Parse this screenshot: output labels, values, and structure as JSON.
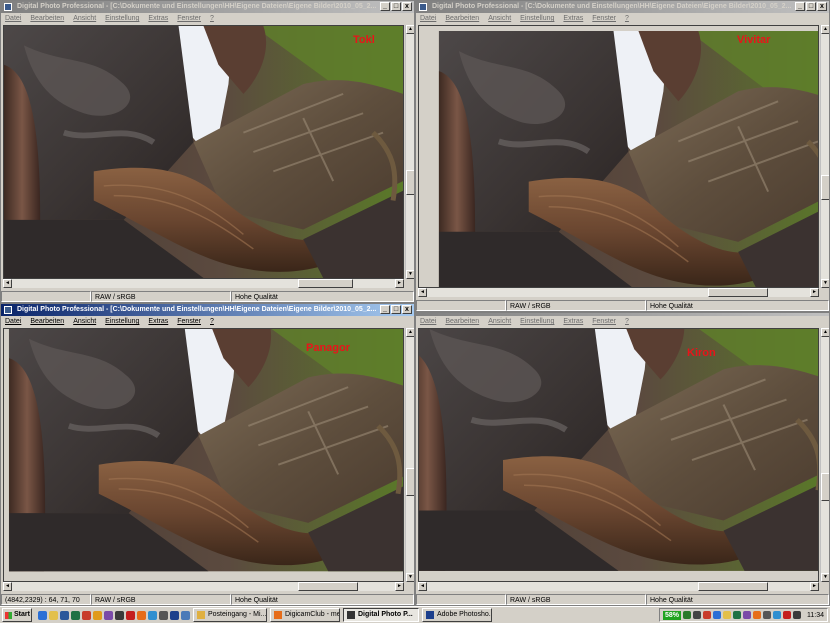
{
  "windows": [
    {
      "title": "Digital Photo Professional - [C:\\Dokumente und Einstellungen\\HH\\Eigene Dateien\\Eigene Bilder\\2010_05_2...",
      "lens_label": "Tokl",
      "status_left": "",
      "status_mid": "RAW / sRGB",
      "status_right": "Hohe Qualität",
      "active": false
    },
    {
      "title": "Digital Photo Professional - [C:\\Dokumente und Einstellungen\\HH\\Eigene Dateien\\Eigene Bilder\\2010_05_2...",
      "lens_label": "Vivitar",
      "status_left": "",
      "status_mid": "RAW / sRGB",
      "status_right": "Hohe Qualität",
      "active": false
    },
    {
      "title": "Digital Photo Professional - [C:\\Dokumente und Einstellungen\\HH\\Eigene Dateien\\Eigene Bilder\\2010_05_2...",
      "lens_label": "Panagor",
      "status_left": "(4842,2329) : 64, 71, 70",
      "status_mid": "RAW / sRGB",
      "status_right": "Hohe Qualität",
      "active": true
    },
    {
      "title": "",
      "lens_label": "Kiron",
      "status_left": "",
      "status_mid": "RAW / sRGB",
      "status_right": "Hohe Qualität",
      "active": false
    }
  ],
  "menu": {
    "datei": "Datei",
    "bearbeiten": "Bearbeiten",
    "ansicht": "Ansicht",
    "einstellung": "Einstellung",
    "extras": "Extras",
    "fenster": "Fenster",
    "help": "?"
  },
  "window_buttons": {
    "minimize": "_",
    "maximize": "□",
    "close": "x"
  },
  "taskbar": {
    "start_label": "Start",
    "tasks": [
      {
        "label": "Posteingang - Mi...",
        "icon": "outlook-icon",
        "pressed": false
      },
      {
        "label": "DigicamClub - me...",
        "icon": "firefox-icon",
        "pressed": false
      },
      {
        "label": "Digital Photo P...",
        "icon": "dpp-icon",
        "pressed": true
      },
      {
        "label": "Adobe Photosho...",
        "icon": "photoshop-icon",
        "pressed": false
      }
    ],
    "battery": "58%",
    "clock": "11:34"
  },
  "colors": {
    "label_red": "#e8141a",
    "title_active": "#0a246a",
    "title_inactive": "#808080"
  }
}
